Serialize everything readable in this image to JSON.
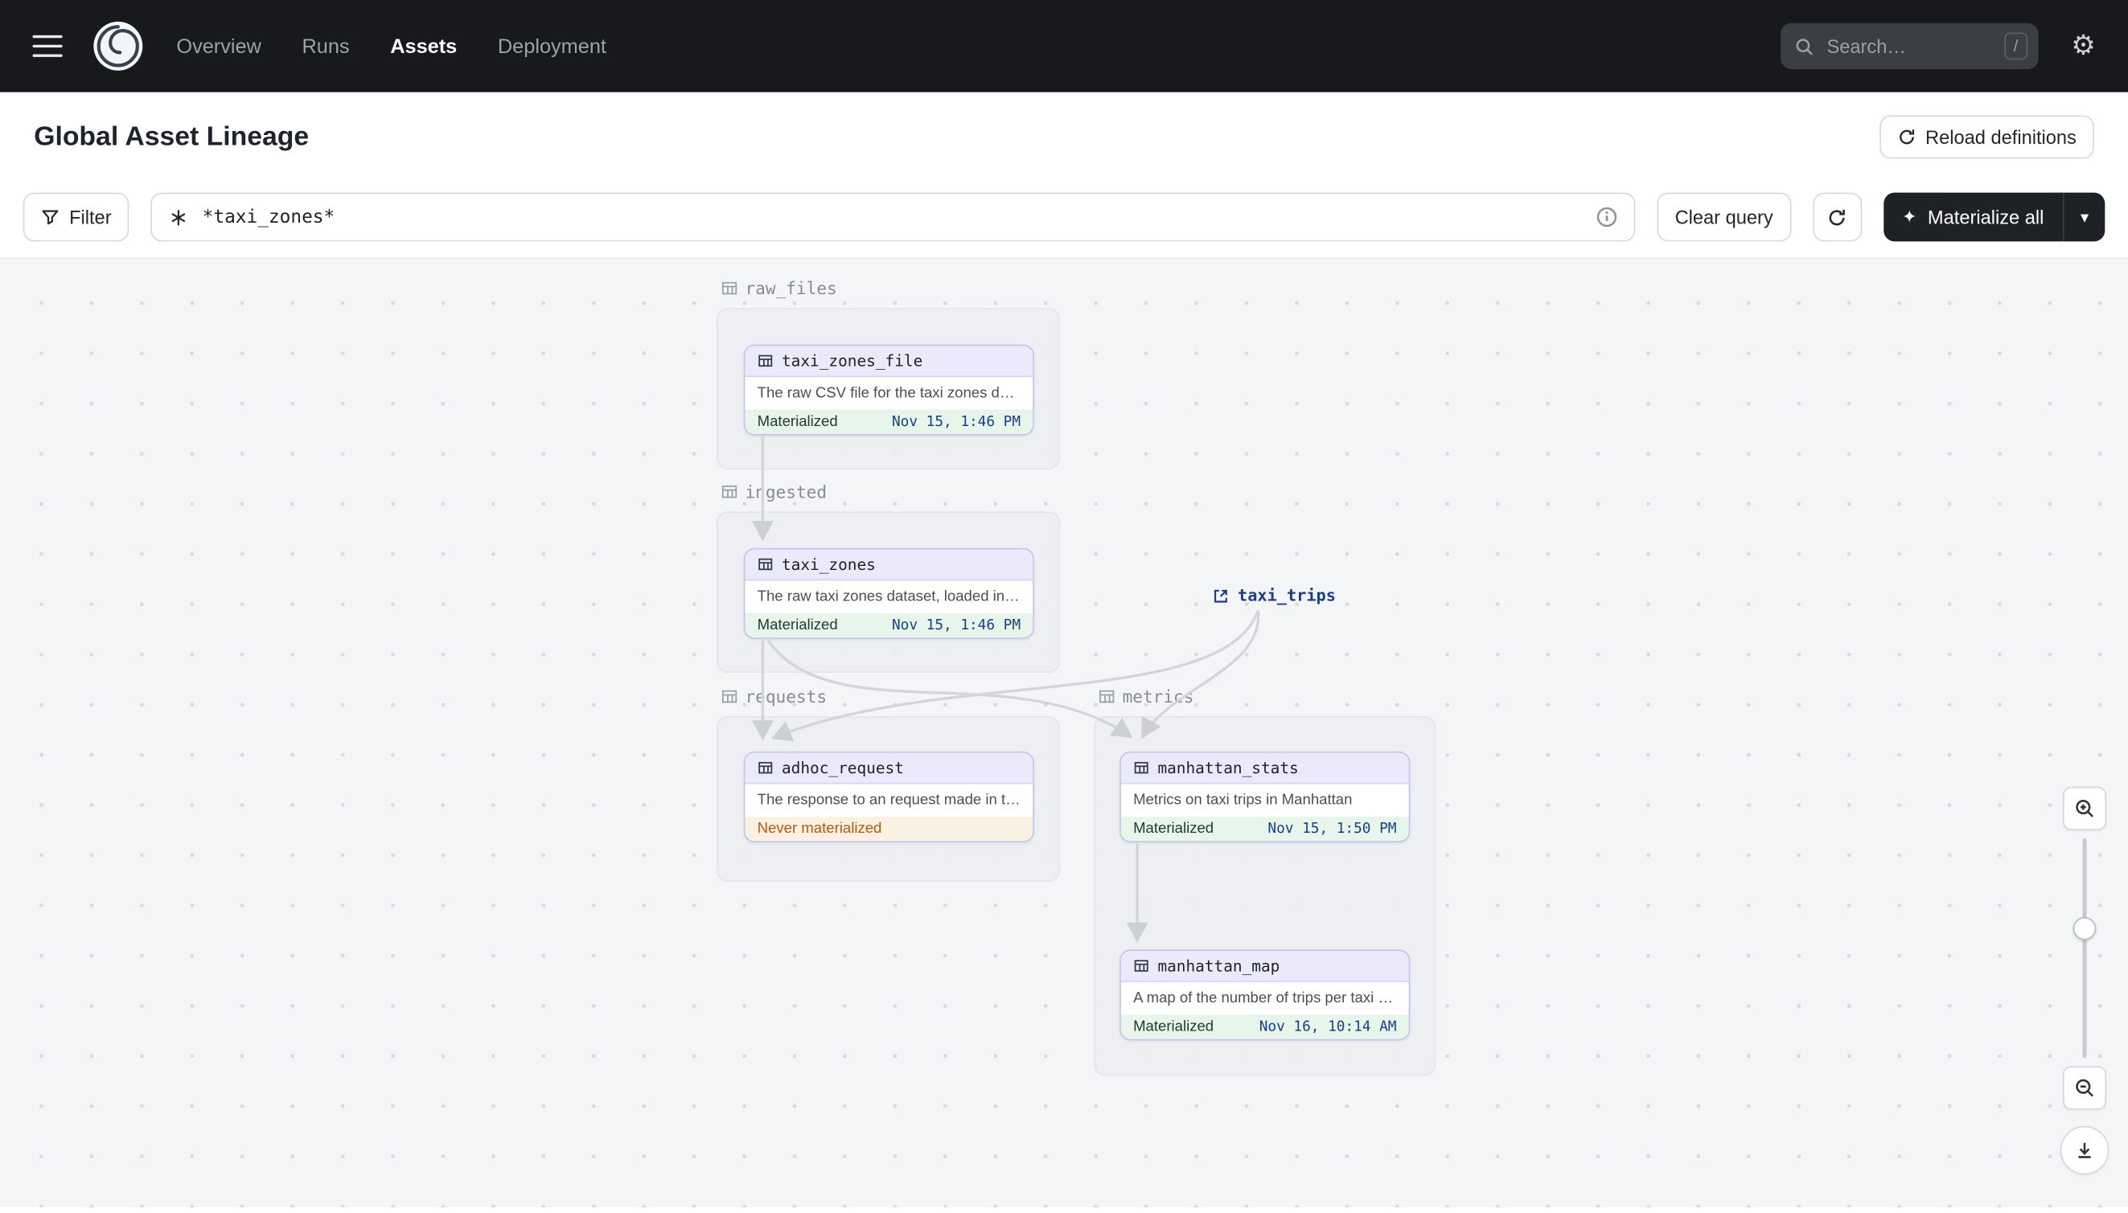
{
  "nav": {
    "items": [
      {
        "label": "Overview",
        "active": false
      },
      {
        "label": "Runs",
        "active": false
      },
      {
        "label": "Assets",
        "active": true
      },
      {
        "label": "Deployment",
        "active": false
      }
    ],
    "search": {
      "placeholder": "Search…",
      "shortcut": "/"
    }
  },
  "header": {
    "title": "Global Asset Lineage",
    "reload_label": "Reload definitions"
  },
  "toolbar": {
    "filter_label": "Filter",
    "query_value": "*taxi_zones*",
    "clear_label": "Clear query",
    "materialize_label": "Materialize all"
  },
  "icons": {
    "sparkle": "✦",
    "caret": "▾",
    "gear": "⚙"
  },
  "graph": {
    "groups": [
      {
        "name": "raw_files"
      },
      {
        "name": "ingested"
      },
      {
        "name": "requests"
      },
      {
        "name": "metrics"
      }
    ],
    "nodes": [
      {
        "id": "taxi_zones_file",
        "name": "taxi_zones_file",
        "description": "The raw CSV file for the taxi zones dat…",
        "status": "Materialized",
        "timestamp": "Nov 15, 1:46 PM"
      },
      {
        "id": "taxi_zones",
        "name": "taxi_zones",
        "description": "The raw taxi zones dataset, loaded int…",
        "status": "Materialized",
        "timestamp": "Nov 15, 1:46 PM"
      },
      {
        "id": "adhoc_request",
        "name": "adhoc_request",
        "description": "The response to an request made in th…",
        "status": "Never materialized",
        "timestamp": ""
      },
      {
        "id": "manhattan_stats",
        "name": "manhattan_stats",
        "description": "Metrics on taxi trips in Manhattan",
        "status": "Materialized",
        "timestamp": "Nov 15, 1:50 PM"
      },
      {
        "id": "manhattan_map",
        "name": "manhattan_map",
        "description": "A map of the number of trips per taxi z…",
        "status": "Materialized",
        "timestamp": "Nov 16, 10:14 AM"
      }
    ],
    "external": [
      {
        "name": "taxi_trips"
      }
    ]
  },
  "colors": {
    "nav_bg": "#17191d",
    "canvas_bg": "#f4f5f7",
    "node_border": "#c6c3ee",
    "node_header_bg": "#ebeafa",
    "status_materialized_bg": "#e8f5eb",
    "status_never_bg": "#fbf1e2",
    "status_never_text": "#b05c13",
    "timestamp_text": "#15418c",
    "external_link": "#1a3e8c",
    "materialize_btn_bg": "#1e2125"
  }
}
